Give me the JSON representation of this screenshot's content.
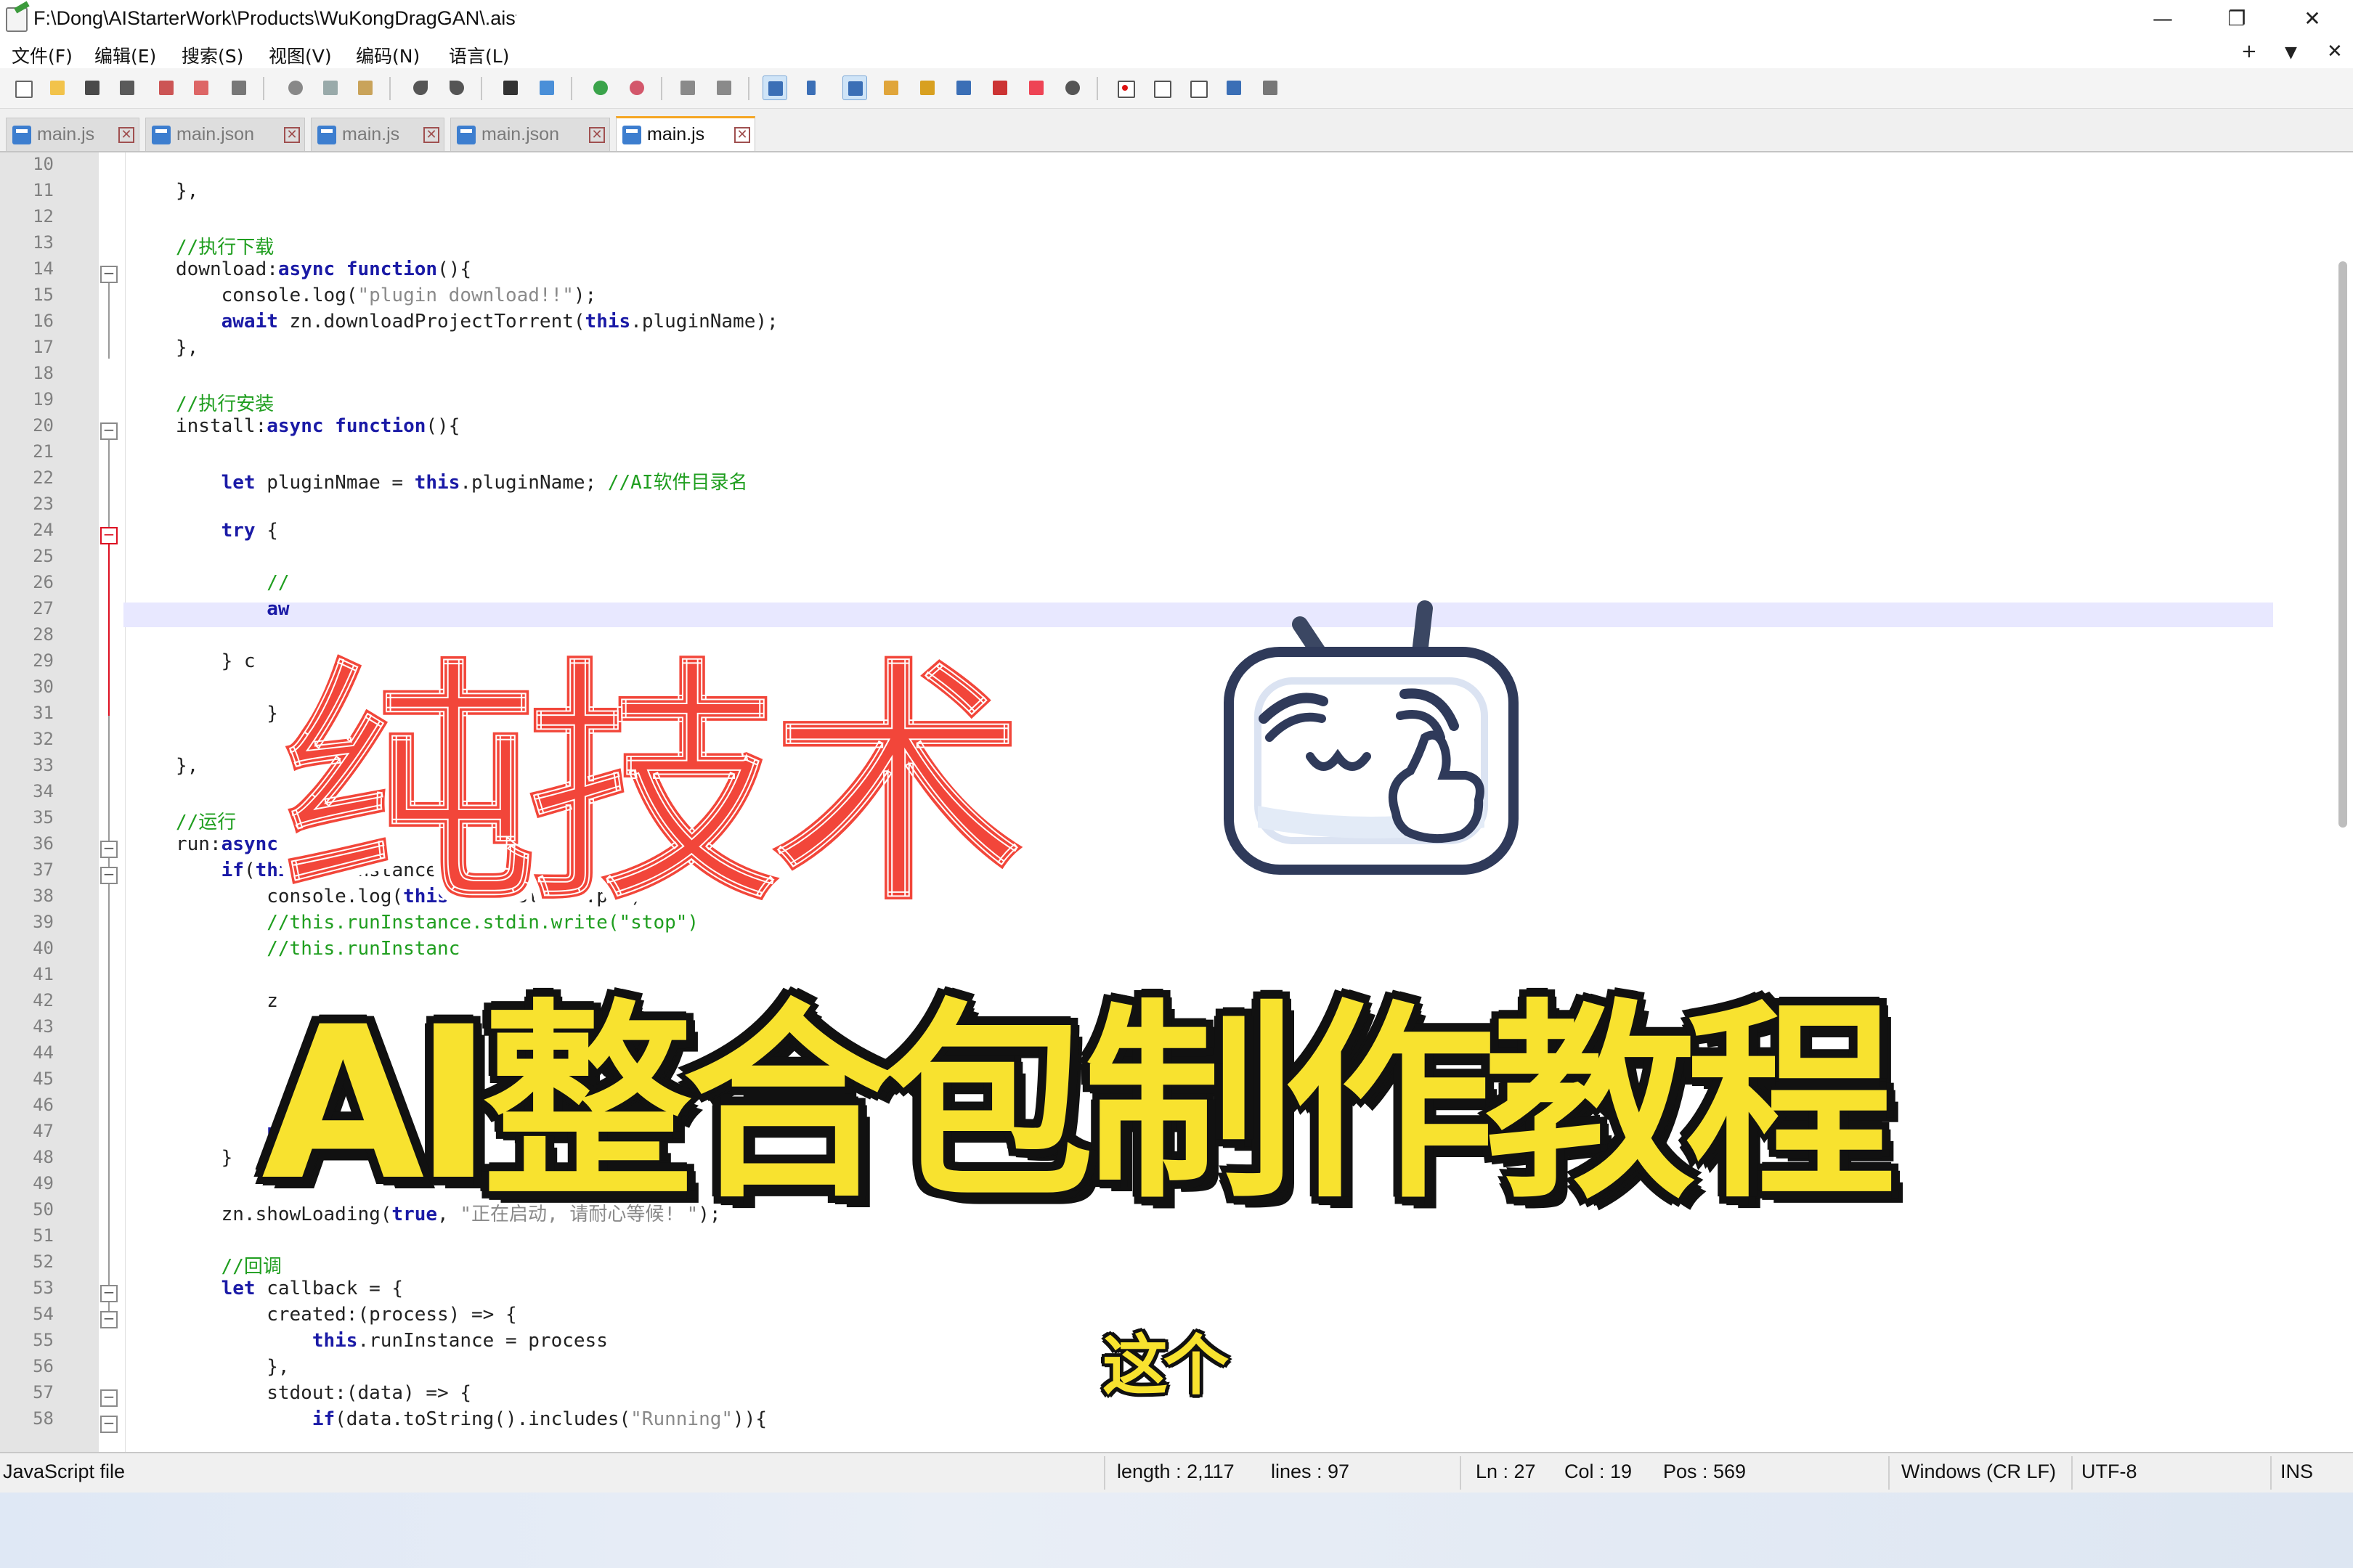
{
  "window": {
    "title_path": "F:\\Dong\\AIStarterWork\\Products\\WuKongDragGAN\\.aist",
    "minimize_glyph": "—",
    "maximize_glyph": "❐",
    "close_glyph": "✕",
    "add_glyph": "+",
    "dropdown_glyph": "▼",
    "close_all_glyph": "✕"
  },
  "menu": [
    "文件(F)",
    "编辑(E)",
    "搜索(S)",
    "视图(V)",
    "编码(N)",
    "语言(L)"
  ],
  "tabs": [
    {
      "label": "main.js",
      "active": false
    },
    {
      "label": "main.json",
      "active": false
    },
    {
      "label": "main.js",
      "active": false
    },
    {
      "label": "main.json",
      "active": false
    },
    {
      "label": "main.js",
      "active": true
    }
  ],
  "tab_close_glyph": "✕",
  "fold_minus": "−",
  "line_numbers": [
    "10",
    "11",
    "12",
    "13",
    "14",
    "15",
    "16",
    "17",
    "18",
    "19",
    "20",
    "21",
    "22",
    "23",
    "24",
    "25",
    "26",
    "27",
    "28",
    "29",
    "30",
    "31",
    "32",
    "33",
    "34",
    "35",
    "36",
    "37",
    "38",
    "39",
    "40",
    "41",
    "42",
    "43",
    "44",
    "45",
    "46",
    "47",
    "48",
    "49",
    "50",
    "51",
    "52",
    "53",
    "54",
    "55",
    "56",
    "57",
    "58"
  ],
  "code_lines": [
    [],
    [
      {
        "t": "},"
      }
    ],
    [],
    [
      {
        "t": "//执行下载",
        "c": "cm"
      }
    ],
    [
      {
        "t": "download:"
      },
      {
        "t": "async",
        "c": "kw"
      },
      {
        "t": " "
      },
      {
        "t": "function",
        "c": "kw"
      },
      {
        "t": "(){"
      }
    ],
    [
      {
        "t": "    console.log("
      },
      {
        "t": "\"plugin download!!\"",
        "c": "st"
      },
      {
        "t": ");"
      }
    ],
    [
      {
        "t": "    "
      },
      {
        "t": "await",
        "c": "kw"
      },
      {
        "t": " zn.downloadProjectTorrent("
      },
      {
        "t": "this",
        "c": "kw"
      },
      {
        "t": ".pluginName);"
      }
    ],
    [
      {
        "t": "},"
      }
    ],
    [],
    [
      {
        "t": "//执行安装",
        "c": "cm"
      }
    ],
    [
      {
        "t": "install:"
      },
      {
        "t": "async",
        "c": "kw"
      },
      {
        "t": " "
      },
      {
        "t": "function",
        "c": "kw"
      },
      {
        "t": "(){"
      }
    ],
    [],
    [
      {
        "t": "    "
      },
      {
        "t": "let",
        "c": "kw"
      },
      {
        "t": " pluginNmae = "
      },
      {
        "t": "this",
        "c": "kw"
      },
      {
        "t": ".pluginName; "
      },
      {
        "t": "//AI软件目录名",
        "c": "cm"
      }
    ],
    [],
    [
      {
        "t": "    "
      },
      {
        "t": "try",
        "c": "kw"
      },
      {
        "t": " {"
      }
    ],
    [],
    [
      {
        "t": "        "
      },
      {
        "t": "//",
        "c": "cm"
      }
    ],
    [
      {
        "t": "        "
      },
      {
        "t": "aw",
        "c": "kw"
      }
    ],
    [],
    [
      {
        "t": "    } c"
      }
    ],
    [],
    [
      {
        "t": "        }"
      }
    ],
    [],
    [
      {
        "t": "},"
      }
    ],
    [],
    [
      {
        "t": "//运行",
        "c": "cm"
      }
    ],
    [
      {
        "t": "run:"
      },
      {
        "t": "async",
        "c": "kw"
      }
    ],
    [
      {
        "t": "    "
      },
      {
        "t": "if",
        "c": "kw"
      },
      {
        "t": "("
      },
      {
        "t": "this",
        "c": "kw"
      },
      {
        "t": ".runInstance){"
      }
    ],
    [
      {
        "t": "        console.log("
      },
      {
        "t": "this",
        "c": "kw"
      },
      {
        "t": ".runInstance.pid)"
      }
    ],
    [
      {
        "t": "        "
      },
      {
        "t": "//this.runInstance.stdin.write(\"stop\")",
        "c": "cm"
      }
    ],
    [
      {
        "t": "        "
      },
      {
        "t": "//this.runInstanc",
        "c": "cm"
      }
    ],
    [],
    [
      {
        "t": "        z"
      }
    ],
    [],
    [],
    [],
    [],
    [
      {
        "t": "        "
      },
      {
        "t": "urn",
        "c": "kw"
      }
    ],
    [
      {
        "t": "    }"
      }
    ],
    [],
    [
      {
        "t": "    zn.showLoading("
      },
      {
        "t": "true",
        "c": "kw"
      },
      {
        "t": ", "
      },
      {
        "t": "\"正在启动, 请耐心等候! \"",
        "c": "st"
      },
      {
        "t": ");"
      }
    ],
    [],
    [
      {
        "t": "    "
      },
      {
        "t": "//回调",
        "c": "cm"
      }
    ],
    [
      {
        "t": "    "
      },
      {
        "t": "let",
        "c": "kw"
      },
      {
        "t": " callback = {"
      }
    ],
    [
      {
        "t": "        created:(process) => {"
      }
    ],
    [
      {
        "t": "            "
      },
      {
        "t": "this",
        "c": "kw"
      },
      {
        "t": ".runInstance = process"
      }
    ],
    [
      {
        "t": "        },"
      }
    ],
    [
      {
        "t": "        stdout:(data) => {"
      }
    ],
    [
      {
        "t": "            "
      },
      {
        "t": "if",
        "c": "kw"
      },
      {
        "t": "(data."
      },
      {
        "t": "toString",
        "c": "fn"
      },
      {
        "t": "().includes("
      },
      {
        "t": "\"Running\"",
        "c": "st"
      },
      {
        "t": ")){"
      }
    ]
  ],
  "overlay": {
    "title_red": "纯技术",
    "title_yellow": "AI整合包制作教程",
    "subtitle": "这个"
  },
  "status": {
    "file_type": "JavaScript file",
    "length": "length : 2,117",
    "lines": "lines : 97",
    "ln": "Ln : 27",
    "col": "Col : 19",
    "pos": "Pos : 569",
    "eol": "Windows (CR LF)",
    "encoding": "UTF-8",
    "mode": "INS"
  },
  "colors": {
    "title_red": "#f2463a",
    "title_yellow": "#f8e22f",
    "keyword": "#1a1aa6",
    "comment": "#1f9e1f",
    "active_tab_accent": "#f5a623"
  }
}
